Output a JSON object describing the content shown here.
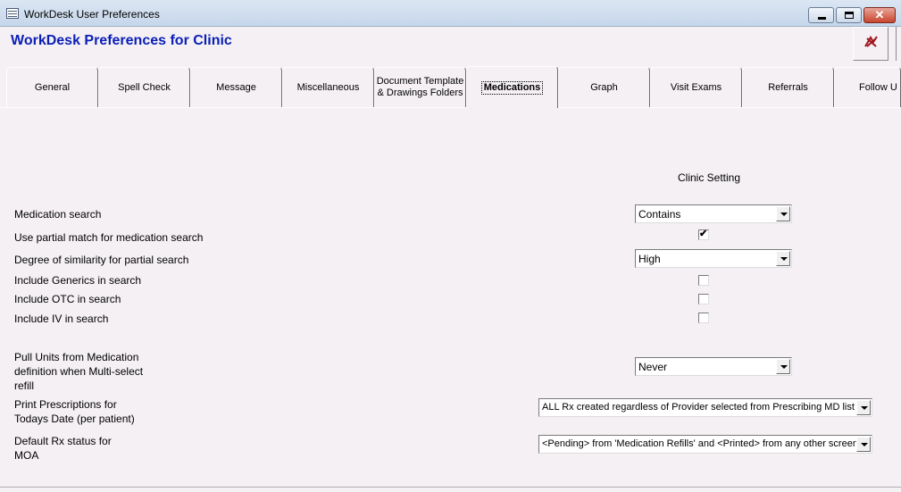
{
  "window": {
    "title": "WorkDesk User Preferences",
    "close_glyph": "✕"
  },
  "header": {
    "title": "WorkDesk Preferences for Clinic",
    "exit_icon": "exit-icon"
  },
  "tabs": [
    {
      "label": "General"
    },
    {
      "label": "Spell Check"
    },
    {
      "label": "Message"
    },
    {
      "label": "Miscellaneous"
    },
    {
      "label": "Document Template & Drawings Folders"
    },
    {
      "label": "Medications",
      "active": true
    },
    {
      "label": "Graph"
    },
    {
      "label": "Visit Exams"
    },
    {
      "label": "Referrals"
    },
    {
      "label": "Follow U"
    }
  ],
  "settings": {
    "column_header": "Clinic Setting",
    "medication_search": {
      "label": "Medication search",
      "value": "Contains"
    },
    "partial_match": {
      "label": "Use partial match for medication search",
      "checked": true
    },
    "similarity": {
      "label": "Degree of similarity for partial search",
      "value": "High"
    },
    "generics": {
      "label": "Include Generics in search",
      "checked": false
    },
    "otc": {
      "label": "Include OTC in search",
      "checked": false
    },
    "iv": {
      "label": "Include IV in search",
      "checked": false
    },
    "pull_units": {
      "label_line1": "Pull Units from Medication",
      "label_line2": "definition when Multi-select",
      "label_line3": "refill",
      "value": "Never"
    },
    "print_rx": {
      "label_line1": "Print Prescriptions for",
      "label_line2": "Todays Date (per patient)",
      "value": "ALL Rx created regardless of Provider selected from Prescribing MD list"
    },
    "default_status": {
      "label_line1": "Default Rx status for",
      "label_line2": "MOA",
      "value": "<Pending> from 'Medication Refills' and <Printed> from any other screen"
    }
  },
  "checkmark_glyph": "✔"
}
